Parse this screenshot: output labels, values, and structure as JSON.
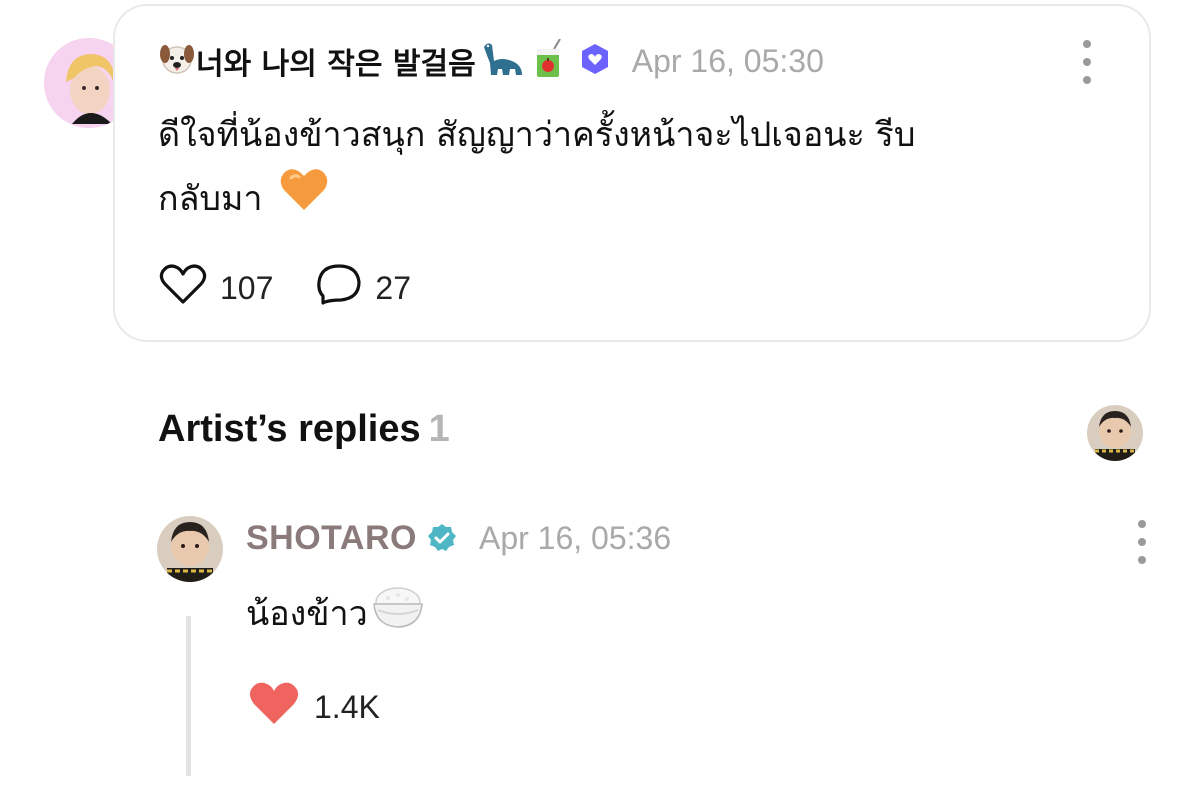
{
  "post": {
    "author_name": "너와 나의 작은 발걸음",
    "author_emojis": [
      "dog-face-icon",
      "sauropod-icon",
      "juice-box-icon"
    ],
    "fan_badge_icon": "heart-badge-icon",
    "timestamp": "Apr 16, 05:30",
    "body_line1": "ดีใจที่น้องข้าวสนุก สัญญาว่าครั้งหน้าจะไปเจอนะ รีบ",
    "body_line2": "กลับมา",
    "body_emoji": "orange-heart-icon",
    "likes": "107",
    "comments": "27"
  },
  "section": {
    "title": "Artist’s replies",
    "count": "1"
  },
  "reply": {
    "author_name": "SHOTARO",
    "timestamp": "Apr 16, 05:36",
    "body": "น้องข้าว",
    "body_emoji": "rice-bowl-icon",
    "likes": "1.4K"
  },
  "colors": {
    "timestamp": "#a9a9a9",
    "artist_name": "#8a7b7a",
    "verified": "#4fb6c6",
    "fan_badge": "#6c63ff",
    "heart_filled": "#f0645f",
    "orange_heart": "#f59a3d",
    "section_count": "#b5b5b5"
  }
}
